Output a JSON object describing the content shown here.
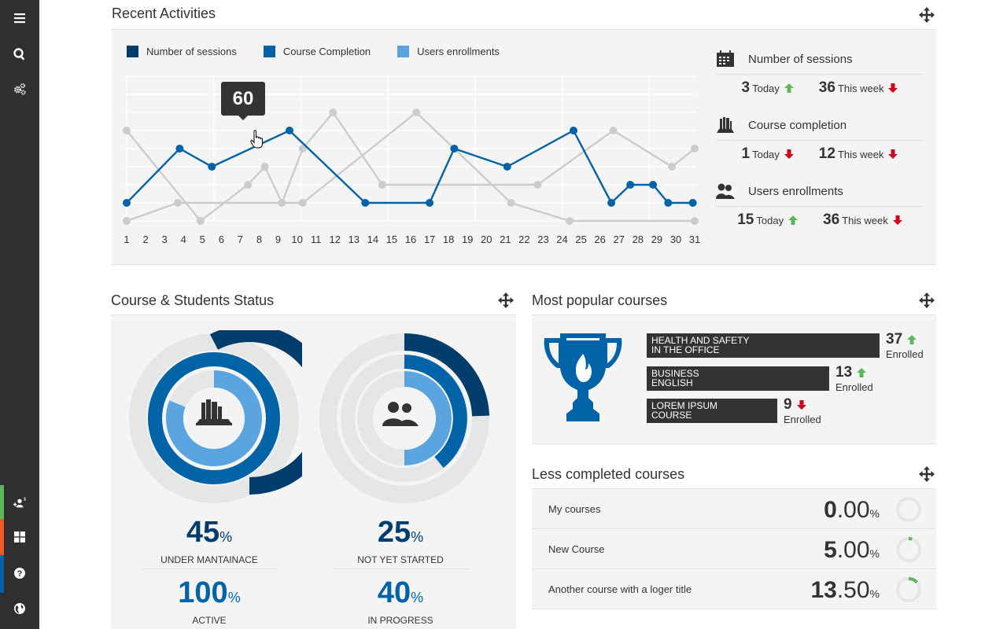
{
  "sidebar": {
    "top_items": [
      {
        "name": "menu",
        "icon": "hamburger-menu-icon"
      },
      {
        "name": "search",
        "icon": "search-icon"
      },
      {
        "name": "settings",
        "icon": "gears-icon"
      }
    ],
    "bottom_items": [
      {
        "name": "user-billing",
        "icon": "add-user-dollar-icon",
        "accent": "#5cb85c"
      },
      {
        "name": "dashboard",
        "icon": "grid-icon",
        "accent": "#f15a24"
      },
      {
        "name": "help",
        "icon": "help-icon",
        "accent": "#0063a8"
      },
      {
        "name": "language",
        "icon": "globe-icon",
        "accent": ""
      }
    ]
  },
  "colors": {
    "sessions": "#003c6c",
    "completion": "#0063a8",
    "enrollments": "#5aa4df",
    "inactive_line": "#cccccc",
    "up": "#5cb85c",
    "down": "#d0021b",
    "ring_bg": "#e5e6e6"
  },
  "recent_activities": {
    "title": "Recent Activities",
    "legend": [
      {
        "label": "Number of sessions",
        "color": "#003c6c"
      },
      {
        "label": "Course Completion",
        "color": "#0063a8"
      },
      {
        "label": "Users enrollments",
        "color": "#5aa4df"
      }
    ],
    "tooltip": "60",
    "stats": [
      {
        "title": "Number of sessions",
        "icon": "calendar-icon",
        "today": "3",
        "today_label": "Today",
        "today_trend": "up",
        "week": "36",
        "week_label": "This week",
        "week_trend": "down"
      },
      {
        "title": "Course completion",
        "icon": "books-icon",
        "today": "1",
        "today_label": "Today",
        "today_trend": "down",
        "week": "12",
        "week_label": "This week",
        "week_trend": "down"
      },
      {
        "title": "Users enrollments",
        "icon": "users-icon",
        "today": "15",
        "today_label": "Today",
        "today_trend": "up",
        "week": "36",
        "week_label": "This week",
        "week_trend": "down"
      }
    ]
  },
  "chart_data": {
    "type": "line",
    "title": "Recent Activities",
    "xlabel": "",
    "ylabel": "",
    "x_ticks": [
      1,
      2,
      3,
      4,
      5,
      6,
      7,
      8,
      9,
      10,
      11,
      12,
      13,
      14,
      15,
      16,
      17,
      18,
      19,
      20,
      21,
      22,
      23,
      24,
      25,
      26,
      27,
      28,
      29,
      30,
      31
    ],
    "xlim": [
      1,
      31
    ],
    "ylim": [
      10,
      90
    ],
    "grid": true,
    "legend_position": "top-left",
    "highlighted_series": "Course Completion",
    "tooltip": {
      "x": 10,
      "value": 60
    },
    "series": [
      {
        "name": "Number of sessions",
        "active": false,
        "points": [
          [
            1,
            60
          ],
          [
            4.9,
            10
          ],
          [
            7.4,
            30
          ],
          [
            8.3,
            40
          ],
          [
            9.2,
            20
          ],
          [
            10.3,
            50
          ],
          [
            11.9,
            70
          ],
          [
            14.5,
            30
          ],
          [
            22.7,
            30
          ],
          [
            26.7,
            60
          ],
          [
            29.8,
            40
          ],
          [
            31,
            50
          ]
        ]
      },
      {
        "name": "Users enrollments",
        "active": false,
        "points": [
          [
            1,
            10
          ],
          [
            3.7,
            20
          ],
          [
            9.2,
            20
          ],
          [
            10.3,
            20
          ],
          [
            16.3,
            70
          ],
          [
            21.3,
            20
          ],
          [
            24.4,
            10
          ],
          [
            31,
            10
          ]
        ]
      },
      {
        "name": "Course Completion",
        "active": true,
        "points": [
          [
            1,
            20
          ],
          [
            3.8,
            50
          ],
          [
            5.5,
            40
          ],
          [
            9.6,
            60
          ],
          [
            13.6,
            20
          ],
          [
            17,
            20
          ],
          [
            18.3,
            50
          ],
          [
            21.1,
            40
          ],
          [
            24.6,
            60
          ],
          [
            26.6,
            20
          ],
          [
            27.6,
            30
          ],
          [
            28.8,
            30
          ],
          [
            29.6,
            20
          ],
          [
            30.9,
            20
          ]
        ]
      }
    ]
  },
  "course_status": {
    "title": "Course & Students Status",
    "left": {
      "icon": "books-icon",
      "top_value": "45",
      "top_label": "UNDER MANTAINACE",
      "bottom_value": "100",
      "bottom_label": "ACTIVE"
    },
    "right": {
      "icon": "users-icon",
      "top_value": "25",
      "top_label": "NOT YET STARTED",
      "bottom_value": "40",
      "bottom_label": "IN PROGRESS"
    },
    "percent_symbol": "%"
  },
  "popular": {
    "title": "Most popular courses",
    "icon": "trophy-icon",
    "courses": [
      {
        "line1": "HEALTH AND SAFETY",
        "line2": "IN THE OFFICE",
        "count": "37",
        "trend": "up",
        "label": "Enrolled"
      },
      {
        "line1": "BUSINESS",
        "line2": "ENGLISH",
        "count": "13",
        "trend": "up",
        "label": "Enrolled"
      },
      {
        "line1": "LOREM IPSUM",
        "line2": "COURSE",
        "count": "9",
        "trend": "down",
        "label": "Enrolled"
      }
    ]
  },
  "less_completed": {
    "title": "Less completed courses",
    "rows": [
      {
        "name": "My courses",
        "int": "0",
        "dec": ".00",
        "pct": "%",
        "value": 0
      },
      {
        "name": "New Course",
        "int": "5",
        "dec": ".00",
        "pct": "%",
        "value": 5
      },
      {
        "name": "Another course with a loger title",
        "int": "13",
        "dec": ".50",
        "pct": "%",
        "value": 13.5
      }
    ]
  }
}
